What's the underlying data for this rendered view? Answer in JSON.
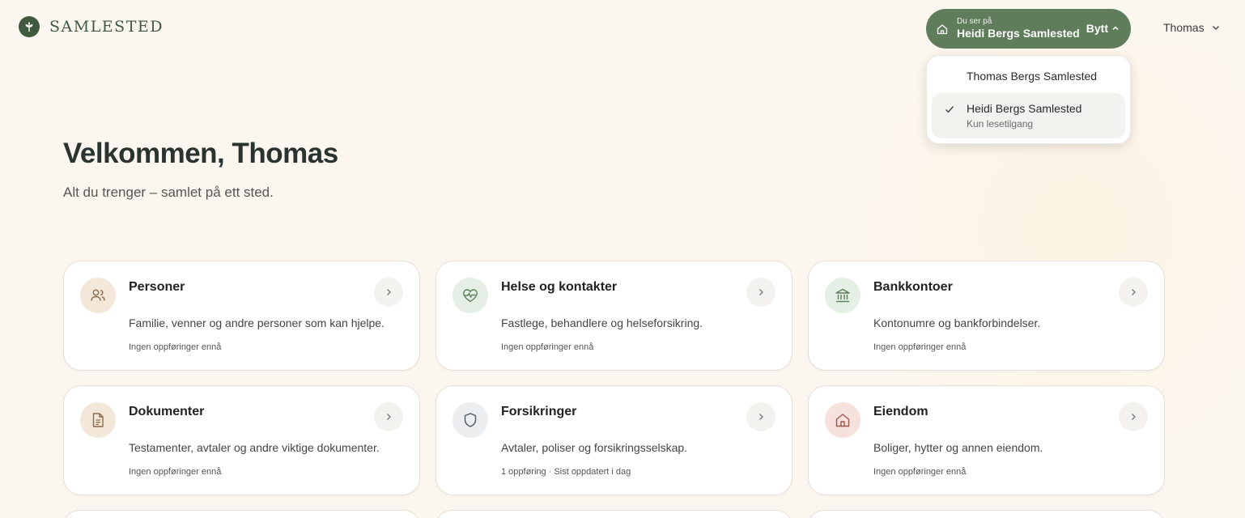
{
  "brand": {
    "name": "SAMLESTED"
  },
  "switcher": {
    "caption": "Du ser på",
    "current": "Heidi Bergs Samlested",
    "action": "Bytt"
  },
  "user": {
    "name": "Thomas"
  },
  "dropdown": {
    "items": [
      {
        "name": "Thomas Bergs Samlested",
        "sub": "",
        "selected": false
      },
      {
        "name": "Heidi Bergs Samlested",
        "sub": "Kun lesetilgang",
        "selected": true
      }
    ]
  },
  "hero": {
    "title": "Velkommen, Thomas",
    "subtitle": "Alt du trenger – samlet på ett sted."
  },
  "cards": [
    {
      "title": "Personer",
      "desc": "Familie, venner og andre personer som kan hjelpe.",
      "meta": "Ingen oppføringer ennå",
      "icon": "people-icon",
      "color": "#f3e7d9"
    },
    {
      "title": "Helse og kontakter",
      "desc": "Fastlege, behandlere og helseforsikring.",
      "meta": "Ingen oppføringer ennå",
      "icon": "heart-pulse-icon",
      "color": "#e6efe6"
    },
    {
      "title": "Bankkontoer",
      "desc": "Kontonumre og bankforbindelser.",
      "meta": "Ingen oppføringer ennå",
      "icon": "bank-icon",
      "color": "#e6efe6"
    },
    {
      "title": "Dokumenter",
      "desc": "Testamenter, avtaler og andre viktige dokumenter.",
      "meta": "Ingen oppføringer ennå",
      "icon": "document-icon",
      "color": "#f3e7d9"
    },
    {
      "title": "Forsikringer",
      "desc": "Avtaler, poliser og forsikringsselskap.",
      "meta": "1 oppføring · Sist oppdatert i dag",
      "icon": "shield-icon",
      "color": "#eceef0"
    },
    {
      "title": "Eiendom",
      "desc": "Boliger, hytter og annen eiendom.",
      "meta": "Ingen oppføringer ennå",
      "icon": "house-icon",
      "color": "#f6e1dc"
    }
  ]
}
